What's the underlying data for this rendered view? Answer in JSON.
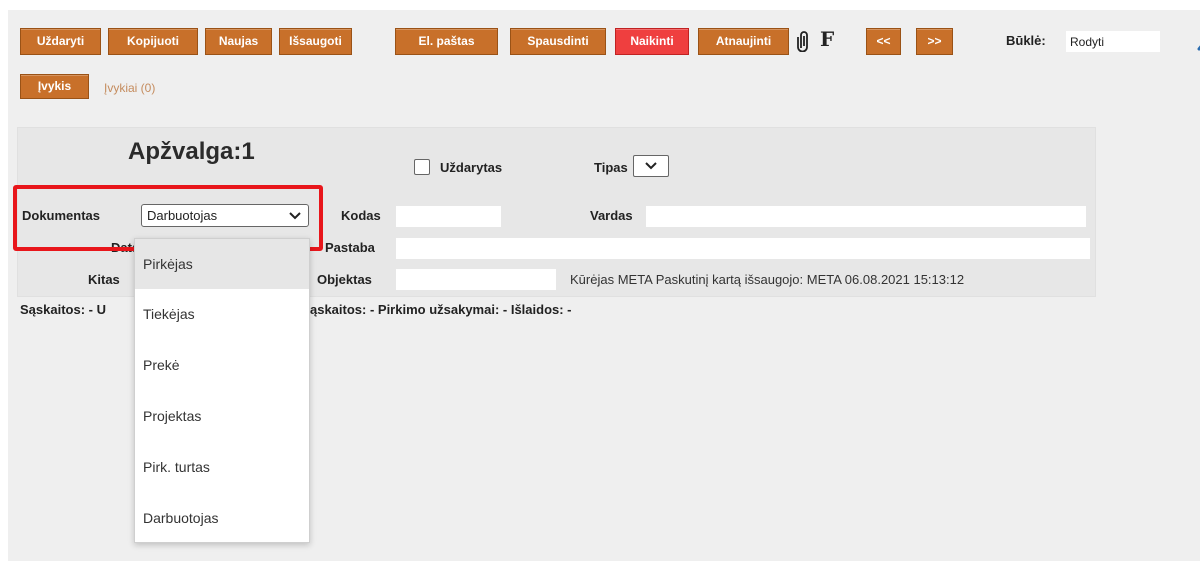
{
  "toolbar": {
    "buttons": [
      {
        "label": "Uždaryti"
      },
      {
        "label": "Kopijuoti"
      },
      {
        "label": "Naujas"
      },
      {
        "label": "Išsaugoti"
      },
      {
        "label": "El. paštas"
      },
      {
        "label": "Spausdinti"
      },
      {
        "label": "Naikinti"
      },
      {
        "label": "Atnaujinti"
      }
    ],
    "attach_icon": "paperclip-icon",
    "f_label": "F",
    "prev_label": "<<",
    "next_label": ">>",
    "status_label": "Būklė:",
    "status_value": "Rodyti",
    "wrench_icon": "wrench-icon"
  },
  "events": {
    "button_label": "Įvykis",
    "link_label": "Įvykiai (0)"
  },
  "form": {
    "title": "Apžvalga:1",
    "closed_label": "Uždarytas",
    "type_label": "Tipas",
    "document_label": "Dokumentas",
    "document_value": "Darbuotojas",
    "code_label": "Kodas",
    "name_label": "Vardas",
    "date_label": "Data",
    "note_label": "Pastaba",
    "other_label": "Kitas",
    "object_label": "Objektas",
    "info_text": "Kūrėjas META  Paskutinį kartą išsaugojo: META 06.08.2021 15:13:12"
  },
  "summary_left": "Sąskaitos: - U",
  "summary_right": "ąskaitos: - Pirkimo užsakymai: - Išlaidos: -",
  "dropdown": {
    "items": [
      "Pirkėjas",
      "Tiekėjas",
      "Prekė",
      "Projektas",
      "Pirk. turtas",
      "Darbuotojas"
    ],
    "highlighted_index": 0
  },
  "colors": {
    "button": "#c8702a",
    "danger_button": "#ef3f3f",
    "highlight_border": "#e8161b"
  }
}
